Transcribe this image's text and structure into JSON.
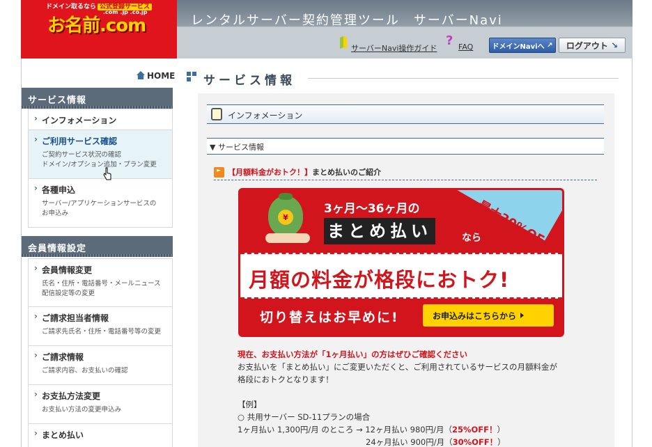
{
  "header": {
    "logo_tag": "ドメイン取るなら",
    "logo_badge": "公式登録サービス",
    "logo_domains": ".com .jp .co.jp",
    "logo_main": "お名前.com",
    "title": "レンタルサーバー契約管理ツール　サーバーNavi",
    "guide_link": "サーバーNavi操作ガイド",
    "faq_link": "FAQ",
    "domain_btn": "ドメインNaviへ",
    "logout_btn": "ログアウト"
  },
  "sidebar": {
    "home": "HOME",
    "sections": [
      {
        "title": "サービス情報",
        "items": [
          {
            "label": "インフォメーション",
            "desc": ""
          },
          {
            "label": "ご利用サービス確認",
            "desc": "ご契約サービス状況の確認\nドメイン/オプション追加・プラン変更"
          },
          {
            "label": "各種申込",
            "desc": "サーバー/アプリケーションサービスの\nお申込み"
          }
        ]
      },
      {
        "title": "会員情報設定",
        "items": [
          {
            "label": "会員情報変更",
            "desc": "氏名・住所・電話番号・メールニュース\n配信設定等の変更"
          },
          {
            "label": "ご請求担当者情報",
            "desc": "ご請求先氏名・住所・電話番号等の変更"
          },
          {
            "label": "ご請求情報",
            "desc": "ご請求内容、お支払いの確認"
          },
          {
            "label": "お支払方法変更",
            "desc": "お支払い方法の変更申込み"
          },
          {
            "label": "まとめ払い",
            "desc": ""
          }
        ]
      }
    ]
  },
  "main": {
    "title": "サービス情報",
    "info_bar": "インフォメーション",
    "service_bar": "▼ サービス情報",
    "promo_head_hl": "【月額料金がおトク！】",
    "promo_head_rest": "まとめ払いのご紹介",
    "banner": {
      "line1": "3ヶ月〜36ヶ月の",
      "line2": "まとめ払い",
      "line2b": "なら",
      "ribbon": "最大30%OFF",
      "middle": "月額の料金が格段におトク!",
      "bottom": "切り替えはお早めに!",
      "cta": "お申込みはこちらから",
      "coin": "¥"
    },
    "notice": "現在、お支払い方法が「1ヶ月払い」の方はぜひご確認ください",
    "body1": "お支払いを「まとめ払い」にご変更いただくと、ご利用されているサービスの月額料金が",
    "body2": "格段におトクとなります！",
    "example_label": "【例】",
    "example_case": "○ 共用サーバー SD-11プランの場合",
    "ex_line1_a": "1ヶ月払い 1,300円/月 のところ → 12ヶ月払い 980円/月（",
    "ex_line1_b": "25%OFF！",
    "ex_line1_c": "）",
    "ex_line2_a": "24ヶ月払い 900円/月（",
    "ex_line2_b": "30%OFF！",
    "ex_line2_c": "）"
  },
  "colors": {
    "brand_red": "#d2141c",
    "accent_blue": "#3c6d9c",
    "logo_yellow": "#ffd200"
  }
}
